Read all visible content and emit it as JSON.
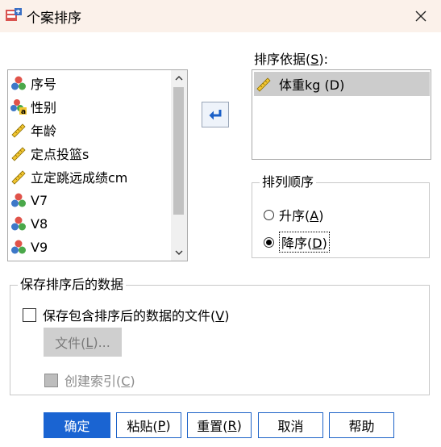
{
  "window": {
    "title": "个案排序",
    "close_icon": "close-icon"
  },
  "variables": [
    {
      "label": "序号",
      "icon": "nominal-icon"
    },
    {
      "label": "性别",
      "icon": "nominal-string-icon"
    },
    {
      "label": "年龄",
      "icon": "scale-ruler-icon"
    },
    {
      "label": "定点投篮s",
      "icon": "scale-ruler-icon"
    },
    {
      "label": "立定跳远成绩cm",
      "icon": "scale-ruler-icon"
    },
    {
      "label": "V7",
      "icon": "nominal-icon"
    },
    {
      "label": "V8",
      "icon": "nominal-icon"
    },
    {
      "label": "V9",
      "icon": "nominal-icon"
    }
  ],
  "sort_by": {
    "label_text": "排序依据(",
    "label_mnemonic": "S",
    "label_suffix": "):",
    "items": [
      {
        "label": "体重kg (D)",
        "icon": "scale-ruler-icon"
      }
    ]
  },
  "sort_order": {
    "title": "排列顺序",
    "ascending": {
      "text": "升序(",
      "mnemonic": "A",
      "suffix": ")",
      "checked": false
    },
    "descending": {
      "text": "降序(",
      "mnemonic": "D",
      "suffix": ")",
      "checked": true
    }
  },
  "save_section": {
    "title": "保存排序后的数据",
    "save_checkbox": {
      "text": "保存包含排序后的数据的文件(",
      "mnemonic": "V",
      "suffix": ")",
      "checked": false
    },
    "file_button": {
      "text": "文件(",
      "mnemonic": "L",
      "suffix": ")..."
    },
    "index_checkbox": {
      "text": "创建索引(",
      "mnemonic": "C",
      "suffix": ")",
      "checked": false
    }
  },
  "buttons": {
    "ok": "确定",
    "paste": {
      "text": "粘贴(",
      "mnemonic": "P",
      "suffix": ")"
    },
    "reset": {
      "text": "重置(",
      "mnemonic": "R",
      "suffix": ")"
    },
    "cancel": "取消",
    "help": "帮助"
  },
  "colors": {
    "accent": "#1a64d2",
    "titlebar": "#fbf1ea",
    "selection": "#cccccc"
  }
}
